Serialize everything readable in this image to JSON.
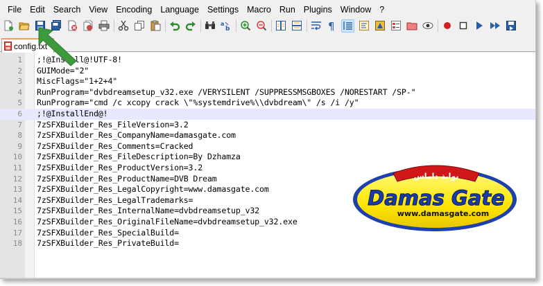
{
  "menu": [
    "File",
    "Edit",
    "Search",
    "View",
    "Encoding",
    "Language",
    "Settings",
    "Macro",
    "Run",
    "Plugins",
    "Window",
    "?"
  ],
  "toolbar": {
    "buttons": [
      {
        "name": "new-file-icon",
        "color": "#ffffff"
      },
      {
        "name": "open-file-icon",
        "color": "#e8b43a"
      },
      {
        "name": "save-icon",
        "color": "#2a5ea8"
      },
      {
        "name": "save-all-icon",
        "color": "#2a5ea8"
      },
      {
        "name": "close-icon",
        "color": "#c94848"
      },
      {
        "name": "close-all-icon",
        "color": "#c94848"
      },
      {
        "name": "print-icon",
        "color": "#555555"
      },
      {
        "name": "cut-icon",
        "color": "#444444"
      },
      {
        "name": "copy-icon",
        "color": "#666666"
      },
      {
        "name": "paste-icon",
        "color": "#b58b3e"
      },
      {
        "name": "undo-icon",
        "color": "#2e8b2e"
      },
      {
        "name": "redo-icon",
        "color": "#2e8b2e"
      },
      {
        "name": "find-icon",
        "color": "#333333"
      },
      {
        "name": "replace-icon",
        "color": "#2a5ea8"
      },
      {
        "name": "zoom-in-icon",
        "color": "#2e8b2e"
      },
      {
        "name": "zoom-out-icon",
        "color": "#c94848"
      },
      {
        "name": "sync-vertical-icon",
        "color": "#2a5ea8"
      },
      {
        "name": "sync-horizontal-icon",
        "color": "#2a5ea8"
      },
      {
        "name": "word-wrap-icon",
        "color": "#2a5ea8"
      },
      {
        "name": "show-all-chars-icon",
        "color": "#2a5ea8"
      },
      {
        "name": "indent-guide-icon",
        "color": "#2a5ea8"
      },
      {
        "name": "user-language-icon",
        "color": "#d8a020"
      },
      {
        "name": "doc-map-icon",
        "color": "#d8a020"
      },
      {
        "name": "function-list-icon",
        "color": "#c94848"
      },
      {
        "name": "folder-workspace-icon",
        "color": "#c94848"
      },
      {
        "name": "monitoring-icon",
        "color": "#555555"
      },
      {
        "name": "record-macro-icon",
        "color": "#d02020"
      },
      {
        "name": "stop-macro-icon",
        "color": "#333333"
      },
      {
        "name": "play-macro-icon",
        "color": "#2a5ea8"
      },
      {
        "name": "play-macro-multiple-icon",
        "color": "#2a5ea8"
      },
      {
        "name": "save-macro-icon",
        "color": "#2a5ea8"
      }
    ]
  },
  "tab": {
    "label": "config.txt"
  },
  "editor": {
    "current_line": 6,
    "lines": [
      ";!@Install@!UTF-8!",
      "GUIMode=\"2\"",
      "MiscFlags=\"1+2+4\"",
      "RunProgram=\"dvbdreamsetup_v32.exe /VERYSILENT /SUPPRESSMSGBOXES /NORESTART /SP-\"",
      "RunProgram=\"cmd /c xcopy crack \\\"%systemdrive%\\\\dvbdream\\\" /s /i /y\"",
      ";!@InstallEnd@!",
      "7zSFXBuilder_Res_FileVersion=3.2",
      "7zSFXBuilder_Res_CompanyName=damasgate.com",
      "7zSFXBuilder_Res_Comments=Cracked",
      "7zSFXBuilder_Res_FileDescription=By Dzhamza",
      "7zSFXBuilder_Res_ProductVersion=3.2",
      "7zSFXBuilder_Res_ProductName=DVB Dream",
      "7zSFXBuilder_Res_LegalCopyright=www.damasgate.com",
      "7zSFXBuilder_Res_LegalTrademarks=",
      "7zSFXBuilder_Res_InternalName=dvbdreamsetup_v32",
      "7zSFXBuilder_Res_OriginalFileName=dvbdreamsetup_v32.exe",
      "7zSFXBuilder_Res_SpecialBuild=",
      "7zSFXBuilder_Res_PrivateBuild="
    ]
  },
  "watermark": {
    "arabic": "بوابة داماس",
    "title": "Damas Gate",
    "url": "www.damasgate.com",
    "colors": {
      "ring": "#1e3fae",
      "fill": "#ffee00",
      "text": "#1a3ca8"
    }
  },
  "arrow_color": "#3c9a3c"
}
